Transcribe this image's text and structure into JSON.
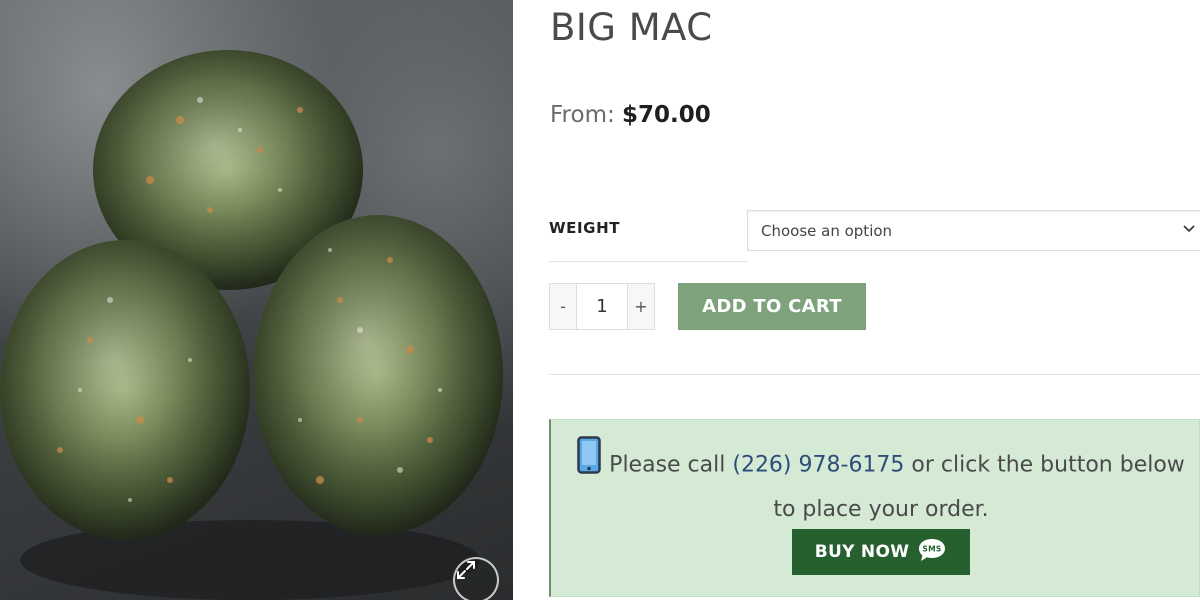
{
  "product": {
    "title": "BIG MAC",
    "price_prefix": "From:",
    "price": "$70.00",
    "image_alt": "cannabis buds product photo"
  },
  "variation": {
    "label": "WEIGHT",
    "selected": "Choose an option"
  },
  "quantity": {
    "minus": "-",
    "value": "1",
    "plus": "+"
  },
  "buttons": {
    "add_to_cart": "ADD TO CART",
    "buy_now": "BUY NOW",
    "sms_badge": "SMS"
  },
  "order_notice": {
    "text_before": "Please call ",
    "phone": "(226) 978-6175",
    "text_after": " or click the button below to place your order."
  },
  "icons": {
    "zoom": "expand-icon",
    "phone": "mobile-phone-icon",
    "chevron": "chevron-down-icon",
    "sms": "sms-bubble-icon"
  },
  "colors": {
    "add_to_cart_bg": "#7ea27c",
    "buy_now_bg": "#27602f",
    "notice_bg": "#d4ead5",
    "phone_link": "#2f4d7a"
  }
}
